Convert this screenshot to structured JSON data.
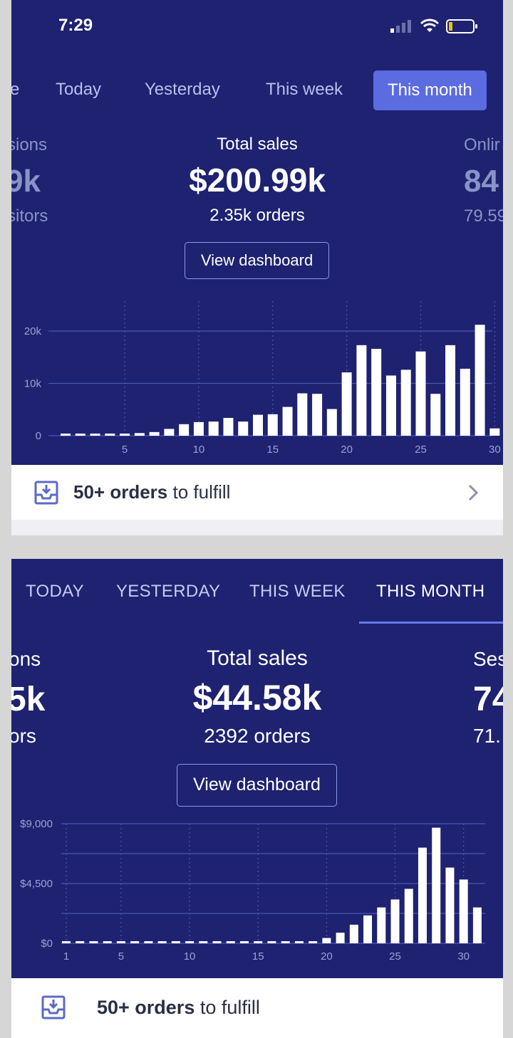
{
  "status_bar": {
    "time": "7:29"
  },
  "panel1": {
    "tabs": [
      "e",
      "Today",
      "Yesterday",
      "This week",
      "This month"
    ],
    "active_tab": "This month",
    "left_metric": {
      "label": "sions",
      "value": "9k",
      "sub": "sitors"
    },
    "center_metric": {
      "label": "Total sales",
      "value": "$200.99k",
      "sub": "2.35k orders"
    },
    "right_metric": {
      "label": "Onlir",
      "value": "84",
      "sub": "79.59"
    },
    "view_dashboard": "View dashboard",
    "fulfill": {
      "bold": "50+ orders",
      "rest": " to fulfill"
    }
  },
  "panel2": {
    "tabs": [
      "TODAY",
      "YESTERDAY",
      "THIS WEEK",
      "THIS MONTH"
    ],
    "active_tab": "THIS MONTH",
    "left_metric": {
      "label": "ons",
      "value": "5k",
      "sub": "ors"
    },
    "center_metric": {
      "label": "Total sales",
      "value": "$44.58k",
      "sub": "2392 orders"
    },
    "right_metric": {
      "label": "Ses",
      "value": "74",
      "sub": "71."
    },
    "view_dashboard": "View dashboard",
    "fulfill": {
      "bold": "50+ orders",
      "rest": " to fulfill"
    }
  },
  "colors": {
    "background": "#1e2270",
    "active_tab": "#5b6be0",
    "bars": "#ffffff",
    "gridline": "#4b56b8"
  },
  "chart_data": [
    {
      "type": "bar",
      "x": [
        1,
        2,
        3,
        4,
        5,
        6,
        7,
        8,
        9,
        10,
        11,
        12,
        13,
        14,
        15,
        16,
        17,
        18,
        19,
        20,
        21,
        22,
        23,
        24,
        25,
        26,
        27,
        28,
        29,
        30,
        31
      ],
      "values": [
        300,
        300,
        300,
        400,
        400,
        500,
        700,
        1300,
        2200,
        2600,
        2700,
        3400,
        2700,
        4000,
        4100,
        5500,
        8100,
        8000,
        5100,
        12100,
        17300,
        16600,
        11500,
        12600,
        16100,
        8000,
        17300,
        12800,
        21200,
        1400,
        0
      ],
      "yticks": [
        "0",
        "10k",
        "20k"
      ],
      "xticks": [
        "5",
        "10",
        "15",
        "20",
        "25",
        "30"
      ],
      "ylim": [
        0,
        20000
      ],
      "grid": true
    },
    {
      "type": "bar",
      "x": [
        1,
        2,
        3,
        4,
        5,
        6,
        7,
        8,
        9,
        10,
        11,
        12,
        13,
        14,
        15,
        16,
        17,
        18,
        19,
        20,
        21,
        22,
        23,
        24,
        25,
        26,
        27,
        28,
        29,
        30,
        31
      ],
      "values": [
        0,
        0,
        0,
        0,
        0,
        0,
        0,
        0,
        0,
        0,
        0,
        0,
        0,
        0,
        0,
        0,
        0,
        0,
        0,
        400,
        800,
        1400,
        2100,
        2700,
        3300,
        4100,
        7200,
        8700,
        5700,
        4800,
        2700
      ],
      "yticks": [
        "$0",
        "$4,500",
        "$9,000"
      ],
      "xticks": [
        "1",
        "5",
        "10",
        "15",
        "20",
        "25",
        "30"
      ],
      "ylim": [
        0,
        9000
      ],
      "grid": true
    }
  ]
}
